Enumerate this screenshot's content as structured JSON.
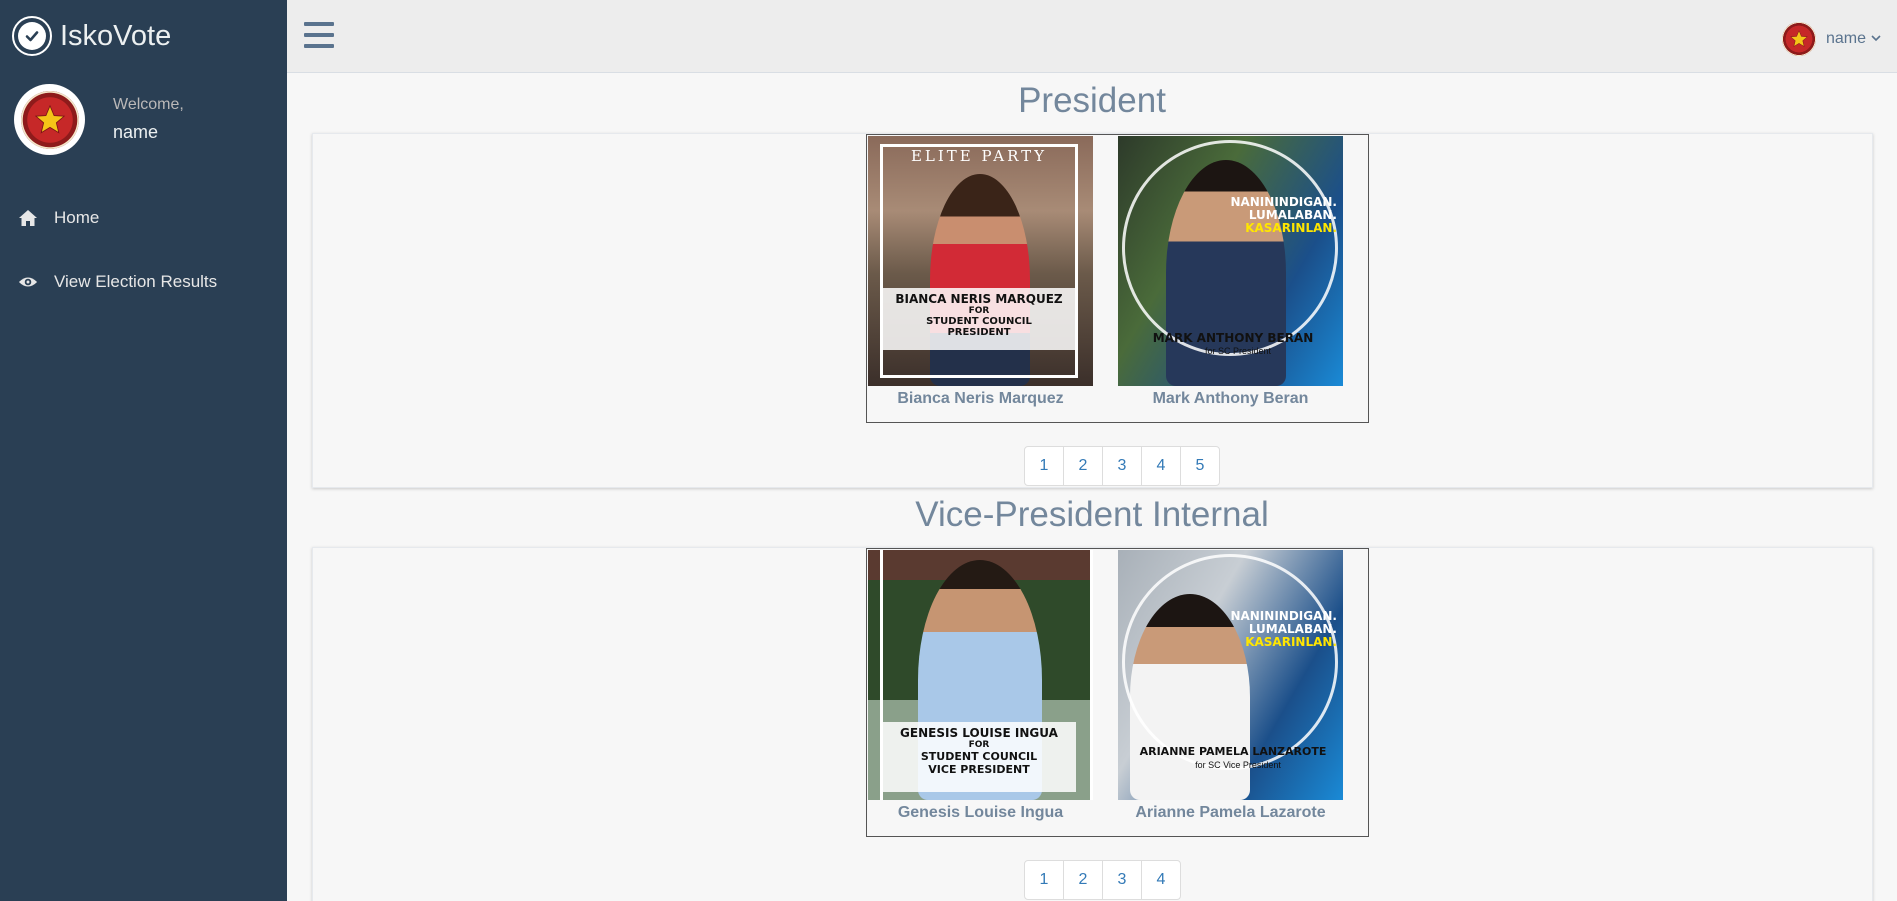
{
  "app": {
    "title": "IskoVote"
  },
  "sidebar": {
    "welcome": "Welcome,",
    "username": "name",
    "items": [
      {
        "label": "Home",
        "icon": "home-icon"
      },
      {
        "label": "View Election Results",
        "icon": "eye-icon"
      }
    ]
  },
  "topnav": {
    "username": "name",
    "icon": "hamburger-menu-icon"
  },
  "sections": [
    {
      "title": "President",
      "candidates": [
        {
          "name": "Bianca Neris Marquez",
          "poster_header": "ELITE PARTY",
          "poster_caption_1": "BIANCA NERIS MARQUEZ",
          "poster_caption_2": "FOR",
          "poster_caption_3": "STUDENT COUNCIL",
          "poster_caption_4": "PRESIDENT"
        },
        {
          "name": "Mark Anthony Beran",
          "poster_slogan_1": "NANININDIGAN.",
          "poster_slogan_2": "LUMALABAN.",
          "poster_slogan_3": "KASARINLAN.",
          "poster_name": "MARK ANTHONY BERAN",
          "poster_sub": "for SC President"
        }
      ],
      "pages": [
        "1",
        "2",
        "3",
        "4",
        "5"
      ]
    },
    {
      "title": "Vice-President Internal",
      "candidates": [
        {
          "name": "Genesis Louise Ingua",
          "poster_caption_1": "GENESIS LOUISE INGUA",
          "poster_caption_2": "FOR",
          "poster_caption_3": "STUDENT COUNCIL",
          "poster_caption_4": "VICE PRESIDENT"
        },
        {
          "name": "Arianne Pamela Lazarote",
          "poster_slogan_1": "NANININDIGAN.",
          "poster_slogan_2": "LUMALABAN.",
          "poster_slogan_3": "KASARINLAN.",
          "poster_name": "ARIANNE PAMELA LANZAROTE",
          "poster_sub": "for SC Vice President"
        }
      ],
      "pages": [
        "1",
        "2",
        "3",
        "4"
      ]
    }
  ],
  "colors": {
    "sidebar": "#2a3f54",
    "accent": "#73879c",
    "link": "#337ab7"
  }
}
